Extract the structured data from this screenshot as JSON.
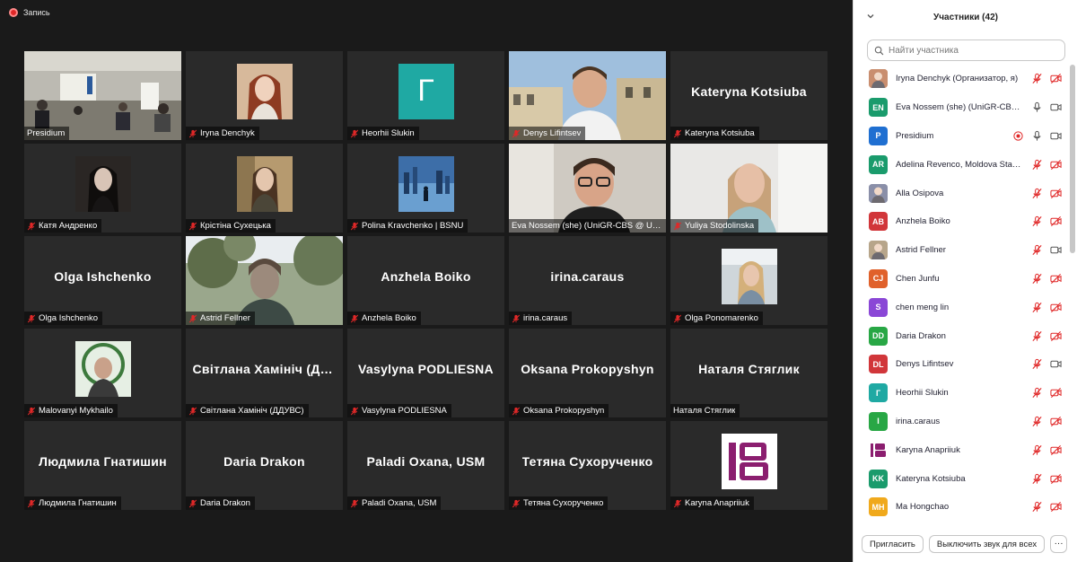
{
  "recording": {
    "label": "Запись"
  },
  "tiles": [
    {
      "name": "Presidium",
      "display": "video",
      "muted": false,
      "video": "conference-room"
    },
    {
      "name": "Iryna Denchyk",
      "display": "photo",
      "muted": true,
      "photo": "woman-red-hair"
    },
    {
      "name": "Heorhii Slukin",
      "display": "letter",
      "letter": "Г",
      "muted": true
    },
    {
      "name": "Denys Lifintsev",
      "display": "video",
      "muted": true,
      "video": "man-street"
    },
    {
      "name": "Kateryna Kotsiuba",
      "display": "text",
      "big": "Kateryna Kotsiuba",
      "muted": true
    },
    {
      "name": "Катя Андренко",
      "display": "photo",
      "muted": true,
      "photo": "woman-dark"
    },
    {
      "name": "Крістіна Сухецька",
      "display": "photo",
      "muted": true,
      "photo": "woman-park"
    },
    {
      "name": "Polina Kravchenko | BSNU",
      "display": "photo",
      "muted": true,
      "photo": "blue-city"
    },
    {
      "name": "Eva Nossem (she) (UniGR-CBS @ UdS)",
      "display": "video",
      "muted": false,
      "active": true,
      "video": "person-glasses"
    },
    {
      "name": "Yuliya Stodolinska",
      "display": "video",
      "muted": true,
      "video": "woman-blonde"
    },
    {
      "name": "Olga Ishchenko",
      "display": "text",
      "big": "Olga Ishchenko",
      "muted": true
    },
    {
      "name": "Astrid Fellner",
      "display": "video",
      "muted": true,
      "video": "woman-trees"
    },
    {
      "name": "Anzhela Boiko",
      "display": "text",
      "big": "Anzhela Boiko",
      "muted": true
    },
    {
      "name": "irina.caraus",
      "display": "text",
      "big": "irina.caraus",
      "muted": true
    },
    {
      "name": "Olga Ponomarenko",
      "display": "photo",
      "muted": true,
      "photo": "woman-office"
    },
    {
      "name": "Malovanyi Mykhailo",
      "display": "photo",
      "muted": true,
      "photo": "man-emblem"
    },
    {
      "name": "Світлана Хамініч (ДДУВС)",
      "display": "text",
      "big": "Світлана Хамініч (ДДУВС)",
      "muted": true
    },
    {
      "name": "Vasylyna PODLIESNA",
      "display": "text",
      "big": "Vasylyna PODLIESNA",
      "muted": true
    },
    {
      "name": "Oksana Prokopyshyn",
      "display": "text",
      "big": "Oksana Prokopyshyn",
      "muted": true
    },
    {
      "name": "Наталя Стяглик",
      "display": "text",
      "big": "Наталя Стяглик",
      "muted": false
    },
    {
      "name": "Людмила Гнатишин",
      "display": "text",
      "big": "Людмила Гнатишин",
      "muted": true
    },
    {
      "name": "Daria Drakon",
      "display": "text",
      "big": "Daria Drakon",
      "muted": true
    },
    {
      "name": "Paladi Oxana, USM",
      "display": "text",
      "big": "Paladi Oxana, USM",
      "muted": true
    },
    {
      "name": "Тетяна Сухорученко",
      "display": "text",
      "big": "Тетяна Сухорученко",
      "muted": true
    },
    {
      "name": "Karyna Anapriiuk",
      "display": "photo",
      "muted": true,
      "photo": "ib-logo"
    }
  ],
  "panel": {
    "title": "Участники (42)",
    "search_placeholder": "Найти участника",
    "participants": [
      {
        "name": "Iryna Denchyk (Организатор, я)",
        "avatar": "photo",
        "color": "#c98e6f",
        "mic": "muted",
        "cam": "off"
      },
      {
        "name": "Eva Nossem (she) (UniGR-CBS @ UdS)",
        "avatar": "EN",
        "color": "#1a9b6c",
        "mic": "on",
        "cam": "on"
      },
      {
        "name": "Presidium",
        "avatar": "P",
        "color": "#1f6fd1",
        "mic": "on",
        "cam": "on",
        "recording": true
      },
      {
        "name": "Adelina Revenco, Moldova State University",
        "avatar": "AR",
        "color": "#1a9b6c",
        "mic": "muted",
        "cam": "off"
      },
      {
        "name": "Alla Osipova",
        "avatar": "photo",
        "color": "#8a8fa8",
        "mic": "muted",
        "cam": "off"
      },
      {
        "name": "Anzhela Boiko",
        "avatar": "AB",
        "color": "#d1363a",
        "mic": "muted",
        "cam": "off"
      },
      {
        "name": "Astrid Fellner",
        "avatar": "photo",
        "color": "#b7a58a",
        "mic": "muted",
        "cam": "on"
      },
      {
        "name": "Chen Junfu",
        "avatar": "CJ",
        "color": "#e0612b",
        "mic": "muted",
        "cam": "off"
      },
      {
        "name": "chen meng lin",
        "avatar": "S",
        "color": "#8a47d6",
        "mic": "muted",
        "cam": "off"
      },
      {
        "name": "Daria Drakon",
        "avatar": "DD",
        "color": "#28a745",
        "mic": "muted",
        "cam": "off"
      },
      {
        "name": "Denys Lifintsev",
        "avatar": "DL",
        "color": "#d1363a",
        "mic": "muted",
        "cam": "on"
      },
      {
        "name": "Heorhii Slukin",
        "avatar": "Г",
        "color": "#1fa9a3",
        "mic": "muted",
        "cam": "off"
      },
      {
        "name": "irina.caraus",
        "avatar": "I",
        "color": "#28a745",
        "mic": "muted",
        "cam": "off"
      },
      {
        "name": "Karyna Anapriiuk",
        "avatar": "logo",
        "color": "#8b1e6f",
        "mic": "muted",
        "cam": "off"
      },
      {
        "name": "Kateryna Kotsiuba",
        "avatar": "KK",
        "color": "#1a9b6c",
        "mic": "muted",
        "cam": "off"
      },
      {
        "name": "Ma Hongchao",
        "avatar": "MH",
        "color": "#f0a91c",
        "mic": "muted",
        "cam": "off"
      }
    ],
    "invite_label": "Пригласить",
    "mute_all_label": "Выключить звук для всех",
    "more_label": "···"
  },
  "colors": {
    "muted_red": "#e02828",
    "active_speaker": "#a7d44a",
    "tile_bg": "#2a2a2a"
  }
}
